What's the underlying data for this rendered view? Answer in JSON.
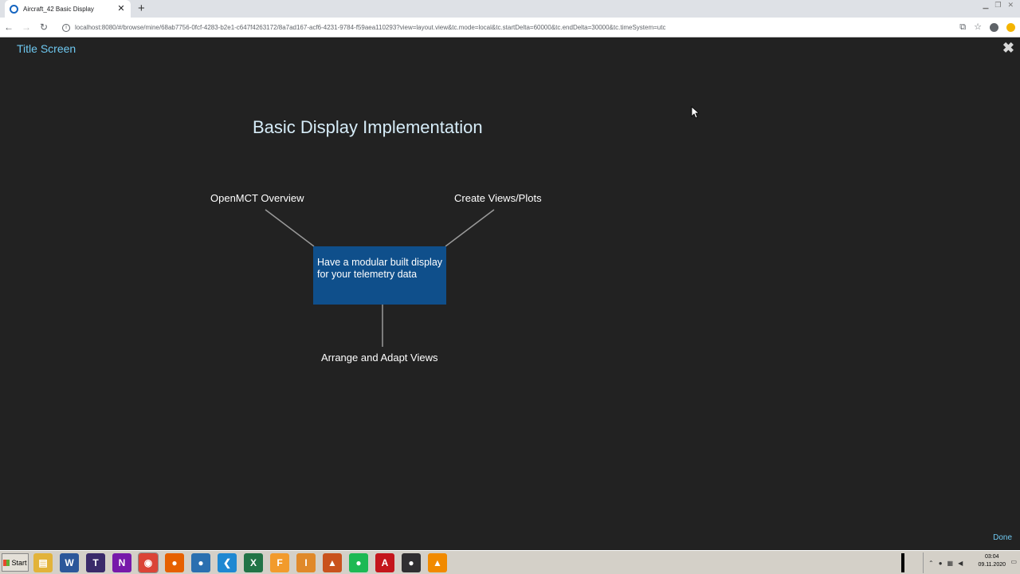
{
  "browser": {
    "tab_title": "Aircraft_42 Basic Display",
    "tab_close": "✕",
    "new_tab": "+",
    "url": "localhost:8080/#/browse/mine/68ab7756-0fcf-4283-b2e1-c647f4263172/8a7ad167-acf6-4231-9784-f59aea110293?view=layout.view&tc.mode=local&tc.startDelta=60000&tc.endDelta=30000&tc.timeSystem=utc"
  },
  "page": {
    "screen_title": "Title Screen",
    "close_glyph": "✖",
    "heading": "Basic Display Implementation",
    "done_label": "Done"
  },
  "diagram": {
    "center_text": "Have a modular built display for your telemetry data",
    "top_left": "OpenMCT Overview",
    "top_right": "Create Views/Plots",
    "bottom": "Arrange and Adapt Views"
  },
  "taskbar": {
    "start_label": "Start",
    "time": "03:04",
    "date": "09.11.2020",
    "apps": [
      {
        "name": "file-explorer",
        "glyph": "▤",
        "color": "#e2b33a"
      },
      {
        "name": "word",
        "glyph": "W",
        "color": "#2b579a"
      },
      {
        "name": "texmaker",
        "glyph": "T",
        "color": "#3a2a6a"
      },
      {
        "name": "onenote",
        "glyph": "N",
        "color": "#7719aa"
      },
      {
        "name": "chrome",
        "glyph": "◉",
        "color": "#db4437"
      },
      {
        "name": "firefox",
        "glyph": "●",
        "color": "#e66000"
      },
      {
        "name": "thunderbird",
        "glyph": "●",
        "color": "#2a6fb0"
      },
      {
        "name": "vscode",
        "glyph": "❮",
        "color": "#1e88d2"
      },
      {
        "name": "excel",
        "glyph": "X",
        "color": "#217346"
      },
      {
        "name": "app-f",
        "glyph": "F",
        "color": "#f29b2c"
      },
      {
        "name": "app-i",
        "glyph": "I",
        "color": "#e0892a"
      },
      {
        "name": "matlab",
        "glyph": "▲",
        "color": "#c9521d"
      },
      {
        "name": "spotify",
        "glyph": "●",
        "color": "#1db954"
      },
      {
        "name": "acrobat",
        "glyph": "A",
        "color": "#c4161c"
      },
      {
        "name": "obs",
        "glyph": "●",
        "color": "#302e31"
      },
      {
        "name": "vlc",
        "glyph": "▲",
        "color": "#f18a00"
      }
    ]
  }
}
